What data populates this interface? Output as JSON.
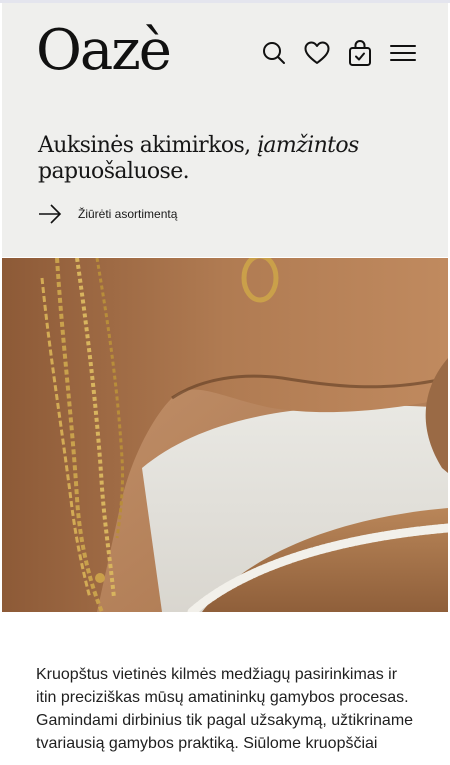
{
  "brand": {
    "logo_text": "Oazè"
  },
  "header": {
    "icons": [
      "search-icon",
      "heart-icon",
      "bag-icon",
      "menu-icon"
    ]
  },
  "hero": {
    "tagline_lead": "Auksinės akimirkos, ",
    "tagline_emphasis": "įamžintos",
    "tagline_tail": "papuošaluose.",
    "cta_label": "Žiūrėti asortimentą",
    "cta_icon": "arrow-right-icon"
  },
  "about": {
    "paragraph": "Kruopštus vietinės kilmės medžiagų pasirinkimas ir itin preciziškas mūsų amatininkų gamybos procesas. Gamindami dirbinius tik pagal užsakymą, užtikriname tvariausią gamybos praktiką. Siūlome kruopščiai"
  },
  "colors": {
    "hero_background": "#efefed",
    "text": "#161616",
    "page_background": "#ffffff"
  }
}
